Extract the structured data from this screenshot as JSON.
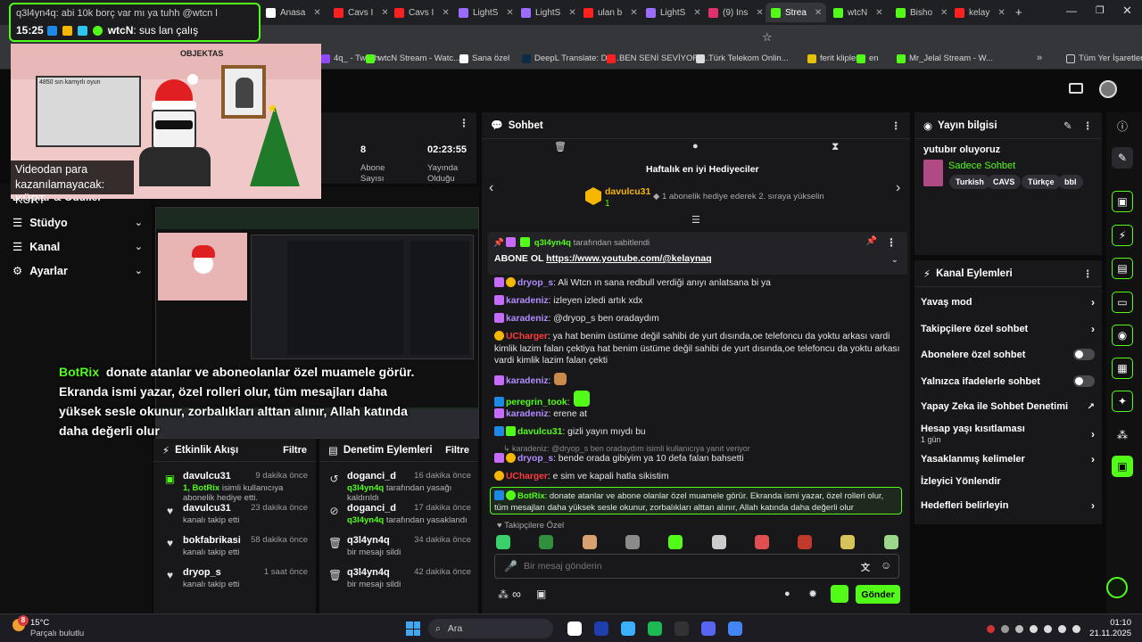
{
  "browser": {
    "tabs": [
      {
        "label": "Anasa",
        "color": "#ffffff"
      },
      {
        "label": "Cavs I",
        "color": "#ff2020"
      },
      {
        "label": "Cavs I",
        "color": "#ff2020"
      },
      {
        "label": "LightS",
        "color": "#9b6cff"
      },
      {
        "label": "LightS",
        "color": "#9b6cff"
      },
      {
        "label": "ulan b",
        "color": "#ff2020"
      },
      {
        "label": "LightS",
        "color": "#9b6cff"
      },
      {
        "label": "(9) Ins",
        "color": "#e1306c"
      },
      {
        "label": "Strea",
        "color": "#53fc18"
      },
      {
        "label": "wtcN",
        "color": "#53fc18"
      },
      {
        "label": "Bisho",
        "color": "#53fc18"
      },
      {
        "label": "kelay",
        "color": "#ff2020"
      }
    ],
    "bookmarks": [
      {
        "label": "4q_ - Twitch"
      },
      {
        "label": "wtcN Stream - Watc..."
      },
      {
        "label": "Sana özel"
      },
      {
        "label": "DeepL Translate: Dü..."
      },
      {
        "label": "BEN SENİ SEVİYORU..."
      },
      {
        "label": "Türk Telekom Onlin..."
      },
      {
        "label": "ferit klipler"
      },
      {
        "label": "en"
      },
      {
        "label": "Mr_Jelal Stream - W..."
      }
    ],
    "bookmarks_all": "Tüm Yer İşaretleri"
  },
  "overlay": {
    "chat_top_line": "q3l4yn4q: abi 10k borç var mı ya tuhh @wtcn l",
    "time": "15:25",
    "chat_user": "wtcN",
    "chat_text": ": sus lan çalış",
    "caption": "Videodan para kazanılamayacak: KÜRT",
    "avatar_sign": "OBJEKTAS",
    "drawing_caption": "4850 sın kamyrlı oyun",
    "botrix_name": "BotRix",
    "botrix_text": "donate atanlar ve aboneolanlar özel muamele görür. Ekranda ismi yazar, özel rolleri olur, tüm mesajları daha yüksek sesle okunur, zorbalıkları alttan alınır, Allah katında daha değerli olur"
  },
  "sidebar": {
    "partial_label": "Droplar & Ödüller",
    "items": [
      {
        "label": "Stüdyo"
      },
      {
        "label": "Kanal"
      },
      {
        "label": "Ayarlar"
      }
    ]
  },
  "stats": {
    "subs_value": "8",
    "subs_label": "Abone Sayısı",
    "uptime_value": "02:23:55",
    "uptime_label": "Yayında Olduğu"
  },
  "activity": {
    "title": "Etkinlik Akışı",
    "filter": "Filtre",
    "items": [
      {
        "name": "davulcu31",
        "time": "9 dakika önce",
        "line1_user": "1, BotRix",
        "line1": " isimli kullanıcıya abonelik hediye etti."
      },
      {
        "name": "davulcu31",
        "time": "23 dakika önce",
        "line1_user": "",
        "line1": "kanalı takip etti"
      },
      {
        "name": "bokfabrikasi",
        "time": "58 dakika önce",
        "line1_user": "",
        "line1": "kanalı takip etti"
      },
      {
        "name": "dryop_s",
        "time": "1 saat önce",
        "line1_user": "",
        "line1": "kanalı takip etti"
      }
    ]
  },
  "moderation": {
    "title": "Denetim Eylemleri",
    "filter": "Filtre",
    "items": [
      {
        "name": "doganci_d",
        "time": "16 dakika önce",
        "by": "q3l4yn4q",
        "line1": " tarafından yasağı kaldırıldı"
      },
      {
        "name": "doganci_d",
        "time": "17 dakika önce",
        "by": "q3l4yn4q",
        "line1": " tarafından yasaklandı"
      },
      {
        "name": "q3l4yn4q",
        "time": "34 dakika önce",
        "by": "",
        "line1": "bir mesajı sildi"
      },
      {
        "name": "q3l4yn4q",
        "time": "42 dakika önce",
        "by": "",
        "line1": "bir mesajı sildi"
      }
    ]
  },
  "chat": {
    "title": "Sohbet",
    "gifters_title": "Haftalık en iyi Hediyeciler",
    "top_gifter": "davulcu31",
    "top_gifter_count": "1",
    "gifter_hint": "1 abonelik hediye ederek 2. sıraya yükselin",
    "pinned_by_user": "q3l4yn4q",
    "pinned_by_text": "tarafından sabitlendi",
    "pinned_msg_prefix": "ABONE OL ",
    "pinned_link": "https://www.youtube.com/@kelaynaq",
    "messages": [
      {
        "user": "dryop_s",
        "cls": "u-purple",
        "text": ": Ali Wtcn ın sana redbull verdiği anıyı anlatsana bi ya"
      },
      {
        "user": "karadeniz",
        "cls": "u-purple",
        "text": ": izleyen izledi artık xdx"
      },
      {
        "user": "karadeniz",
        "cls": "u-purple",
        "text": ": @dryop_s ben oradaydım"
      },
      {
        "user": "UCharger",
        "cls": "u-red",
        "text": ": ya hat benim üstüme değil sahibi de yurt dısında,oe telefoncu da yoktu arkası vardi kimlik lazim falan çektiya hat benim üstüme değil sahibi de yurt dısında,oe telefoncu da yoktu arkası vardi kimlik lazim falan çekti"
      },
      {
        "user": "karadeniz",
        "cls": "u-purple",
        "text": ":"
      },
      {
        "user": "peregrin_took",
        "cls": "u-green",
        "text": ":"
      },
      {
        "user": "karadeniz",
        "cls": "u-purple",
        "text": ": erene at"
      },
      {
        "user": "davulcu31",
        "cls": "u-green",
        "text": ": gizli yayın mıydı bu"
      },
      {
        "user": "dryop_s",
        "cls": "u-purple",
        "text": ": bende orada gibiyim ya 10 defa falan bahsetti"
      },
      {
        "user": "UCharger",
        "cls": "u-red",
        "text": ": e sim ve kapali hatla sikistim"
      }
    ],
    "reply_hint": "karadeniz: @dryop_s ben oradaydım isimli kullanıcıya yanıt veriyor",
    "bot_user": "BotRix",
    "bot_text": ": donate atanlar ve abone olanlar özel muamele görür. Ekranda ismi yazar, özel rolleri olur, tüm mesajları daha yüksek sesle okunur, zorbalıkları alttan alınır, Allah katında daha değerli olur",
    "followers_only": "Takipçilere Özel",
    "input_placeholder": "Bir mesaj gönderin",
    "send": "Gönder"
  },
  "stream_info": {
    "title": "Yayın bilgisi",
    "stream_title": "yutubır oluyoruz",
    "category": "Sadece Sohbet",
    "tags": [
      "Turkish",
      "CAVS",
      "Türkçe",
      "bbl"
    ]
  },
  "channel_actions": {
    "title": "Kanal Eylemleri",
    "rows": [
      {
        "label": "Yavaş mod",
        "kind": "chev"
      },
      {
        "label": "Takipçilere özel sohbet",
        "kind": "chev"
      },
      {
        "label": "Abonelere özel sohbet",
        "kind": "toggle"
      },
      {
        "label": "Yalnızca ifadelerle sohbet",
        "kind": "toggle"
      },
      {
        "label": "Yapay Zeka ile Sohbet Denetimi",
        "kind": "ext"
      },
      {
        "label": "Hesap yaşı kısıtlaması",
        "kind": "chev",
        "sub": "1 gün"
      },
      {
        "label": "Yasaklanmış kelimeler",
        "kind": "chev"
      },
      {
        "label": "İzleyici Yönlendir",
        "kind": "none"
      },
      {
        "label": "Hedefleri belirleyin",
        "kind": "chev"
      }
    ]
  },
  "taskbar": {
    "weather_temp": "15°C",
    "weather_desc": "Parçalı bulutlu",
    "search": "Ara",
    "time": "01:10",
    "date": "21.11.2025",
    "notif_count": "8"
  }
}
